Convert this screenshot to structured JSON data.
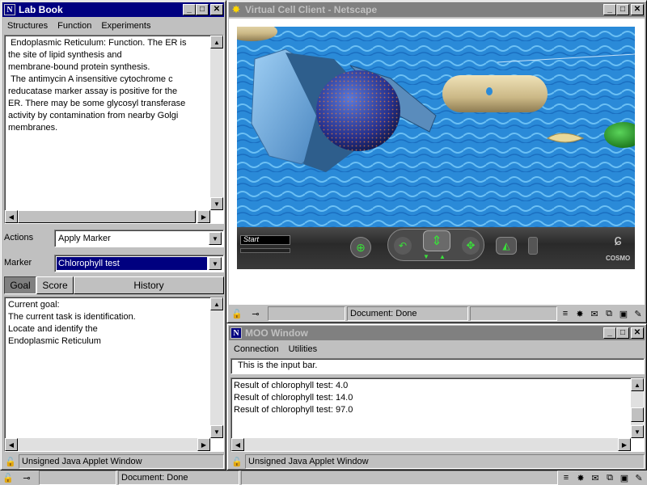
{
  "lab_book": {
    "title": "Lab Book",
    "menu": [
      "Structures",
      "Function",
      "Experiments"
    ],
    "description": " Endoplasmic Reticulum: Function. The ER is\nthe site of lipid synthesis and\nmembrane-bound protein synthesis.\n The antimycin A insensitive cytochrome c\nreducatase marker assay is positive for the\nER. There may be some glycosyl transferase\nactivity by contamination from nearby Golgi\nmembranes.",
    "actions_label": "Actions",
    "actions_value": "Apply Marker",
    "marker_label": "Marker",
    "marker_value": "Chlorophyll test",
    "tabs": [
      "Goal",
      "Score",
      "History"
    ],
    "goal_text": "Current goal:\nThe current task is identification.\nLocate and identify the\nEndoplasmic Reticulum",
    "status": "Unsigned Java Applet Window"
  },
  "virtual_cell": {
    "title": "Virtual Cell Client - Netscape",
    "nav_field": "Start",
    "brand": "COSMO",
    "status": "Document: Done"
  },
  "moo": {
    "title": "MOO Window",
    "menu": [
      "Connection",
      "Utilities"
    ],
    "input_bar": "This is the input bar.",
    "results": [
      "Result of chlorophyll test: 4.0",
      "Result of chlorophyll test: 14.0",
      "Result of chlorophyll test: 97.0"
    ],
    "status": "Unsigned Java Applet Window"
  },
  "taskbar": {
    "status": "Document: Done"
  },
  "colors": {
    "title_active": "#000080",
    "title_inactive": "#808080",
    "water": "#2a8ad8"
  }
}
